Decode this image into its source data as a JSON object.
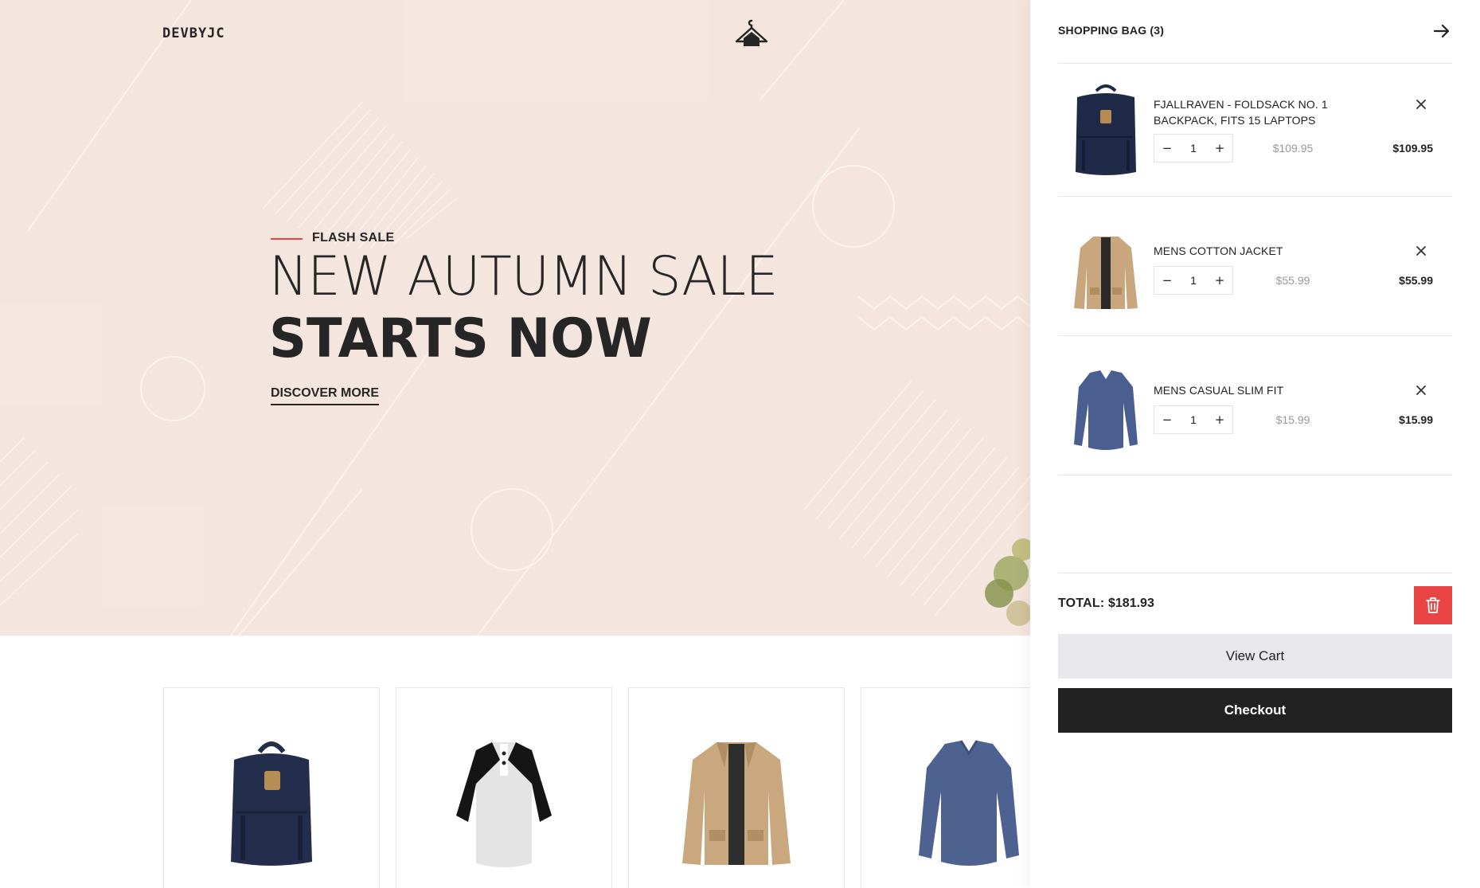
{
  "colors": {
    "hero_bg": "#f4e5df",
    "accent_red": "#e94545",
    "dark": "#222222",
    "muted_price": "#999999",
    "button_gray": "#e8e8ec"
  },
  "header": {
    "brand": "DEVBYJC",
    "logo_icon": "hanger-icon"
  },
  "hero": {
    "eyebrow": "FLASH SALE",
    "headline_line1": "NEW AUTUMN SALE",
    "headline_line2": "STARTS NOW",
    "cta": "DISCOVER MORE"
  },
  "products": [
    {
      "icon": "backpack-icon"
    },
    {
      "icon": "raglan-shirt-icon"
    },
    {
      "icon": "jacket-icon"
    },
    {
      "icon": "longsleeve-shirt-icon"
    }
  ],
  "cart": {
    "title": "SHOPPING BAG (3)",
    "close_icon": "arrow-right-icon",
    "items": [
      {
        "name": "FJALLRAVEN - FOLDSACK NO. 1 BACKPACK, FITS 15 LAPTOPS",
        "qty": "1",
        "unit_price": "$109.95",
        "line_total": "$109.95",
        "icon": "backpack-icon"
      },
      {
        "name": "MENS COTTON JACKET",
        "qty": "1",
        "unit_price": "$55.99",
        "line_total": "$55.99",
        "icon": "jacket-icon"
      },
      {
        "name": "MENS CASUAL SLIM FIT",
        "qty": "1",
        "unit_price": "$15.99",
        "line_total": "$15.99",
        "icon": "longsleeve-shirt-icon"
      }
    ],
    "qty_minus": "−",
    "qty_plus": "+",
    "total_label": "TOTAL:",
    "total_value": "$181.93",
    "view_cart": "View Cart",
    "checkout": "Checkout"
  }
}
